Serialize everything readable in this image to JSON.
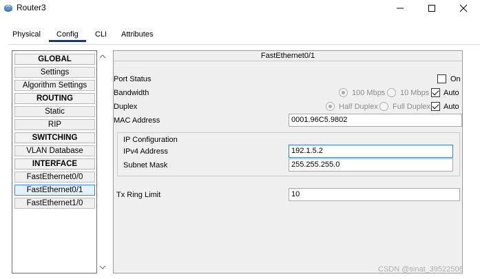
{
  "window": {
    "title": "Router3"
  },
  "tabs": [
    {
      "label": "Physical"
    },
    {
      "label": "Config"
    },
    {
      "label": "CLI"
    },
    {
      "label": "Attributes"
    }
  ],
  "sidebar": {
    "items": [
      {
        "label": "GLOBAL"
      },
      {
        "label": "Settings"
      },
      {
        "label": "Algorithm Settings"
      },
      {
        "label": "ROUTING"
      },
      {
        "label": "Static"
      },
      {
        "label": "RIP"
      },
      {
        "label": "SWITCHING"
      },
      {
        "label": "VLAN Database"
      },
      {
        "label": "INTERFACE"
      },
      {
        "label": "FastEthernet0/0"
      },
      {
        "label": "FastEthernet0/1"
      },
      {
        "label": "FastEthernet1/0"
      }
    ]
  },
  "panel": {
    "title": "FastEthernet0/1",
    "port_status": {
      "label": "Port Status",
      "on_label": "On",
      "on_checked": false
    },
    "bandwidth": {
      "label": "Bandwidth",
      "opt1": "100 Mbps",
      "opt2": "10 Mbps",
      "auto_label": "Auto",
      "auto_checked": true
    },
    "duplex": {
      "label": "Duplex",
      "opt1": "Half Duplex",
      "opt2": "Full Duplex",
      "auto_label": "Auto",
      "auto_checked": true
    },
    "mac": {
      "label": "MAC Address",
      "value": "0001.96C5.9802"
    },
    "ip_config": {
      "heading": "IP Configuration",
      "ipv4_label": "IPv4 Address",
      "ipv4_value": "192.1.5.2",
      "mask_label": "Subnet Mask",
      "mask_value": "255.255.255.0"
    },
    "tx_ring": {
      "label": "Tx Ring Limit",
      "value": "10"
    }
  },
  "watermark": "CSDN @sinat_39522506",
  "colors": {
    "tab_underline": "#1e3a5f",
    "selected_border": "#3c8ad6",
    "focus_border": "#3c7fc1"
  }
}
